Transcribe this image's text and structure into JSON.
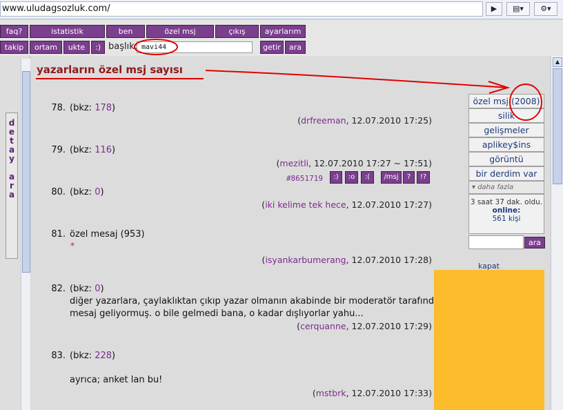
{
  "browser": {
    "url": "www.uludagsozluk.com/",
    "go_glyph": "▶",
    "page_glyph": "▤▾",
    "tools_glyph": "⚙▾"
  },
  "topnav": {
    "row1": [
      "faq?",
      "istatistik",
      "ben",
      "özel msj",
      "çıkış",
      "ayarlarım"
    ],
    "row2": [
      "takip",
      "ortam",
      "ukte",
      ":)"
    ],
    "baslik_label": "başlık:",
    "baslik_value": "mavi44",
    "getir": "getir",
    "ara": "ara"
  },
  "sidebar": {
    "detay_ara": "detay\nara"
  },
  "annotation": {
    "title": "yazarların özel msj sayısı"
  },
  "entries": [
    {
      "num": "78.",
      "bkz_prefix": "(bkz: ",
      "bkz": "178",
      "bkz_suffix": ")",
      "author": "drfreeman",
      "time": ", 12.07.2010 17:25)"
    },
    {
      "num": "79.",
      "bkz_prefix": "(bkz: ",
      "bkz": "116",
      "bkz_suffix": ")",
      "author": "mezitli",
      "time": ", 12.07.2010 17:27 ~ 17:51)"
    },
    {
      "num": "80.",
      "bkz_prefix": "(bkz: ",
      "bkz": "0",
      "bkz_suffix": ")",
      "author": "iki kelime tek hece",
      "time": ", 12.07.2010 17:27)"
    },
    {
      "num": "81.",
      "text": "özel mesaj (953)",
      "star": "*",
      "author": "isyankarbumerang",
      "time": ", 12.07.2010 17:28)"
    },
    {
      "num": "82.",
      "bkz_prefix": "(bkz: ",
      "bkz": "0",
      "bkz_suffix": ")",
      "line2": "diğer yazarlara, çaylaklıktan çıkıp yazar olmanın akabinde bir moderatör tarafından",
      "line3": "mesaj geliyormuş. o bile gelmedi bana, o kadar dışlıyorlar yahu...",
      "author": "cerquanne",
      "time": ", 12.07.2010 17:29)"
    },
    {
      "num": "83.",
      "bkz_prefix": "(bkz: ",
      "bkz": "228",
      "bkz_suffix": ")",
      "line2": "ayrıca; anket lan bu!",
      "author": "mstbrk",
      "time": ", 12.07.2010 17:33)"
    }
  ],
  "author_open": "(",
  "entry_tools": {
    "id": "#8651719",
    "buttons": [
      ":)",
      ":o",
      ":(",
      "/msj",
      "?",
      "!?"
    ]
  },
  "rightpanel": {
    "ozel_msj_label": "özel msj ",
    "ozel_msj_count": "(2008)",
    "items": [
      "silik",
      "gelişmeler",
      "aplikey$ins",
      "görüntü",
      "bir derdim var"
    ],
    "daha_fazla": "▾ daha fazla",
    "time_ago": "3 saat 37 dak. oldu.",
    "online_label": "online:",
    "online_count": "561 kişi",
    "ara": "ara",
    "kapat": "kapat",
    "ad_color": "#fdbc2b"
  }
}
